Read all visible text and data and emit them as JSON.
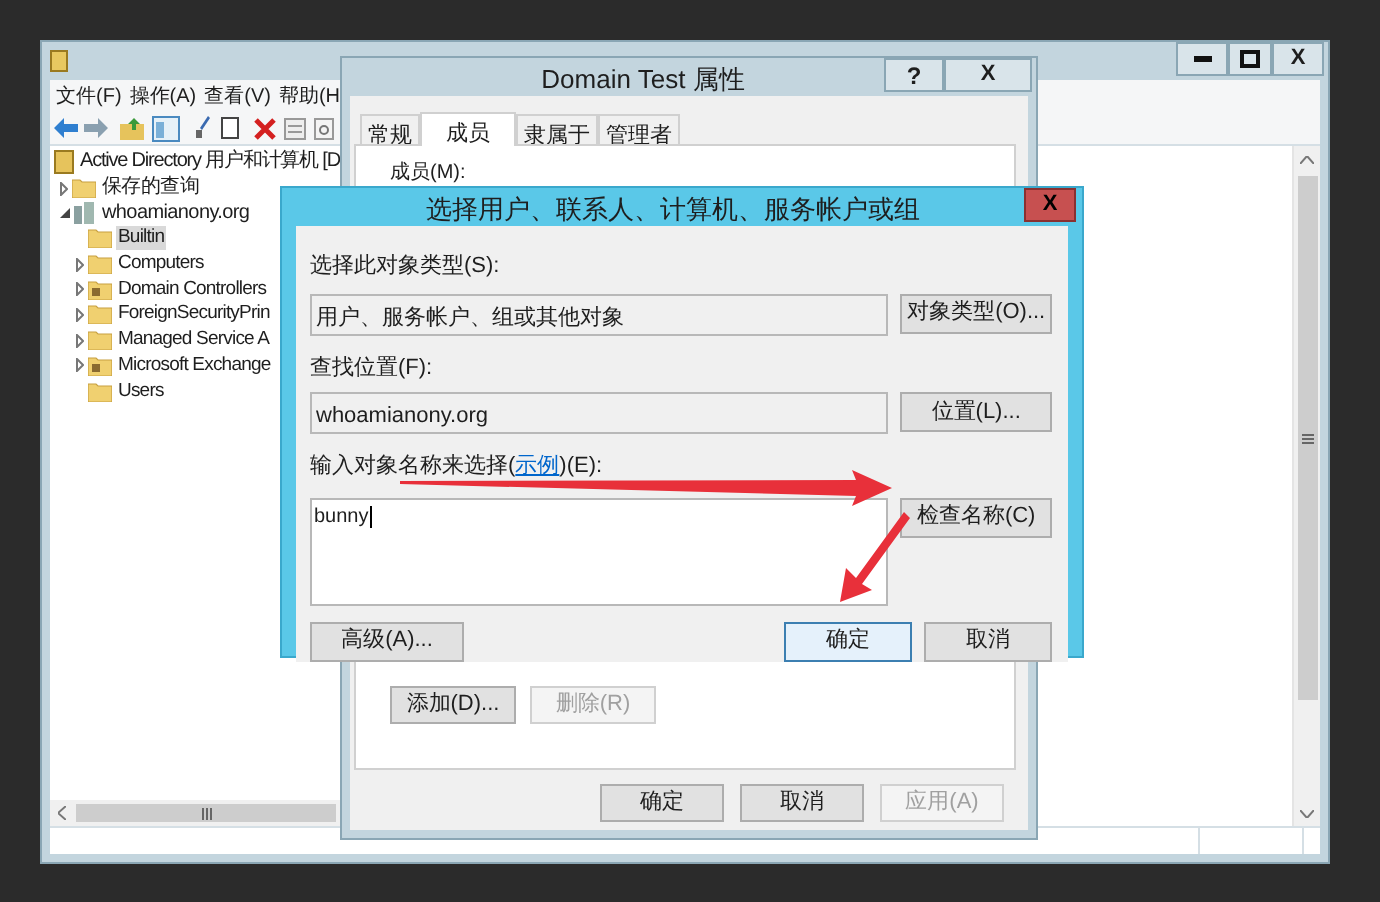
{
  "main_window": {
    "close_button": "X",
    "menu": [
      "文件(F)",
      "操作(A)",
      "查看(V)",
      "帮助(H"
    ],
    "tree": [
      {
        "label": "Active Directory 用户和计算机 [D",
        "kind": "root",
        "selected": false,
        "children": [
          {
            "label": "保存的查询",
            "kind": "folder",
            "expanded": false,
            "selected": false
          },
          {
            "label": "whoamianony.org",
            "kind": "domain",
            "expanded": true,
            "selected": false,
            "children": [
              {
                "label": "Builtin",
                "kind": "folder",
                "selected": true
              },
              {
                "label": "Computers",
                "kind": "folder",
                "expanded": false,
                "selected": false
              },
              {
                "label": "Domain Controllers",
                "kind": "unit",
                "expanded": false,
                "selected": false
              },
              {
                "label": "ForeignSecurityPrin",
                "kind": "folder",
                "expanded": false,
                "selected": false
              },
              {
                "label": "Managed Service A",
                "kind": "folder",
                "expanded": false,
                "selected": false
              },
              {
                "label": "Microsoft Exchange",
                "kind": "unit",
                "expanded": false,
                "selected": false
              },
              {
                "label": "Users",
                "kind": "folder",
                "selected": false
              }
            ]
          }
        ]
      }
    ]
  },
  "properties_dialog": {
    "title": "Domain Test 属性",
    "help_button": "?",
    "close_button": "X",
    "tabs": [
      {
        "label": "常规",
        "selected": false
      },
      {
        "label": "成员",
        "selected": true
      },
      {
        "label": "隶属于",
        "selected": false
      },
      {
        "label": "管理者",
        "selected": false
      }
    ],
    "members_label": "成员(M):",
    "list_buttons": [
      {
        "label": "添加(D)...",
        "disabled": false
      },
      {
        "label": "删除(R)",
        "disabled": true
      }
    ],
    "footer_buttons": [
      {
        "label": "确定",
        "disabled": false
      },
      {
        "label": "取消",
        "disabled": false
      },
      {
        "label": "应用(A)",
        "disabled": true
      }
    ]
  },
  "select_dialog": {
    "title": "选择用户、联系人、计算机、服务帐户或组",
    "close_button": "X",
    "object_type_label": "选择此对象类型(S):",
    "object_type_value": "用户、服务帐户、组或其他对象",
    "object_type_button": "对象类型(O)...",
    "location_label": "查找位置(F):",
    "location_value": "whoamianony.org",
    "location_button": "位置(L)...",
    "name_label": {
      "before": "输入对象名称来选择(",
      "link": "示例",
      "after": ")(E):"
    },
    "name_value": "bunny",
    "check_button": "检查名称(C)",
    "advanced_button": "高级(A)...",
    "footer_buttons": [
      {
        "label": "确定",
        "focused": true
      },
      {
        "label": "取消",
        "focused": false
      }
    ]
  }
}
